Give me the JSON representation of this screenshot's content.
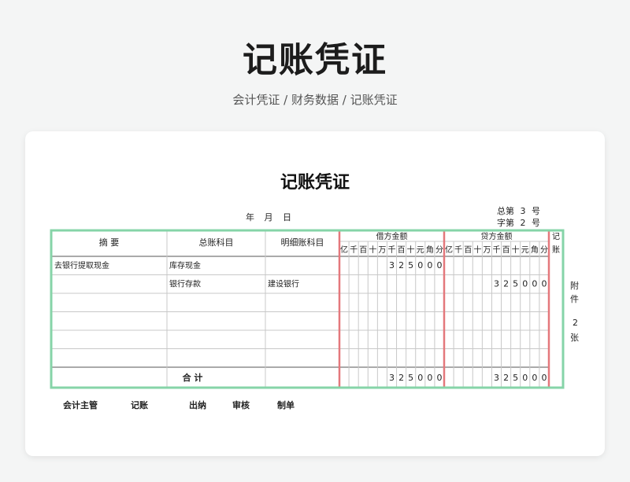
{
  "header": {
    "title": "记账凭证",
    "breadcrumb": "会计凭证 / 财务数据 / 记账凭证"
  },
  "voucher": {
    "title": "记账凭证",
    "date_label": "年 月 日",
    "total_no_prefix": "总第",
    "total_no": "3",
    "total_no_suffix": "号",
    "char_no_prefix": "字第",
    "char_no": "2",
    "char_no_suffix": "号",
    "attachment": {
      "top": "附",
      "bottom": "件",
      "count": "2",
      "unit": "张"
    }
  },
  "table": {
    "headers": {
      "summary": "摘 要",
      "general_account": "总账科目",
      "detail_account": "明细账科目",
      "debit": "借方金额",
      "credit": "贷方金额",
      "posted": "记账"
    },
    "digit_labels": [
      "亿",
      "千",
      "百",
      "十",
      "万",
      "千",
      "百",
      "十",
      "元",
      "角",
      "分"
    ],
    "rows": [
      {
        "summary": "去银行提取现金",
        "general": "库存现金",
        "detail": "",
        "debit": "325000",
        "credit": ""
      },
      {
        "summary": "",
        "general": "银行存款",
        "detail": "建设银行",
        "debit": "",
        "credit": "325000"
      },
      {
        "summary": "",
        "general": "",
        "detail": "",
        "debit": "",
        "credit": ""
      },
      {
        "summary": "",
        "general": "",
        "detail": "",
        "debit": "",
        "credit": ""
      },
      {
        "summary": "",
        "general": "",
        "detail": "",
        "debit": "",
        "credit": ""
      },
      {
        "summary": "",
        "general": "",
        "detail": "",
        "debit": "",
        "credit": ""
      }
    ],
    "total_label": "合 计",
    "total_debit": "325000",
    "total_credit": "325000"
  },
  "signers": {
    "accounting_supervisor": "会计主管",
    "bookkeeping": "记账",
    "cashier": "出纳",
    "review": "审核",
    "preparer": "制单"
  },
  "colors": {
    "outer_border": "#86d4a8",
    "separator": "#e4787c",
    "grid": "#c8c8c8"
  }
}
